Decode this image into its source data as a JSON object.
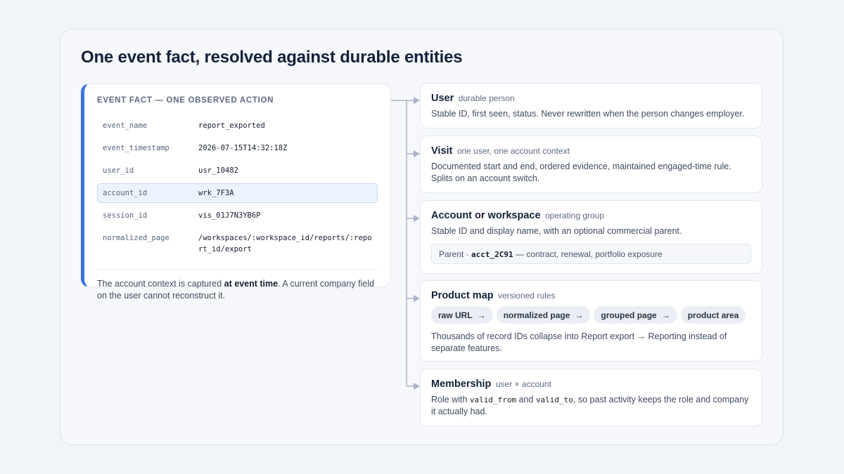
{
  "title": "One event fact, resolved against durable entities",
  "event": {
    "heading": "EVENT FACT — ONE OBSERVED ACTION",
    "fields": [
      {
        "key": "event_name",
        "value": "report_exported"
      },
      {
        "key": "event_timestamp",
        "value": "2026-07-15T14:32:18Z"
      },
      {
        "key": "user_id",
        "value": "usr_10482"
      },
      {
        "key": "account_id",
        "value": "wrk_7F3A"
      },
      {
        "key": "session_id",
        "value": "vis_01J7N3YB6P"
      },
      {
        "key": "normalized_page",
        "value": "/workspaces/:workspace_id/reports/:report_id/export"
      }
    ],
    "note_before": "The account context is captured ",
    "note_bold": "at event time",
    "note_after": ". A current company field on the user cannot reconstruct it."
  },
  "entities": {
    "user": {
      "title": "User",
      "subtitle": "durable person",
      "description": "Stable ID, first seen, status. Never rewritten when the person changes employer."
    },
    "visit": {
      "title": "Visit",
      "subtitle": "one user, one account context",
      "description": "Documented start and end, ordered evidence, maintained engaged-time rule. Splits on an account switch."
    },
    "account": {
      "title": "Account or workspace",
      "subtitle": "operating group",
      "description": "Stable ID and display name, with an optional commercial parent.",
      "parent_prefix": "Parent · ",
      "parent_id": "acct_2C91",
      "parent_suffix": " — contract, renewal, portfolio exposure"
    },
    "product_map": {
      "title": "Product map",
      "subtitle": "versioned rules",
      "chips": [
        "raw URL",
        "normalized page",
        "grouped page",
        "product area"
      ],
      "chip_arrow": "→",
      "description": "Thousands of record IDs collapse into Report export → Reporting instead of separate features."
    },
    "membership": {
      "title": "Membership",
      "subtitle": "user × account",
      "desc_1": "Role with ",
      "code_1": "valid_from",
      "desc_2": " and ",
      "code_2": "valid_to",
      "desc_3": ", so past activity keeps the role and company it actually had."
    }
  },
  "colors": {
    "accent": "#3a73e0",
    "highlight_bg": "#edf3fd",
    "connector": "#aab4c4"
  }
}
